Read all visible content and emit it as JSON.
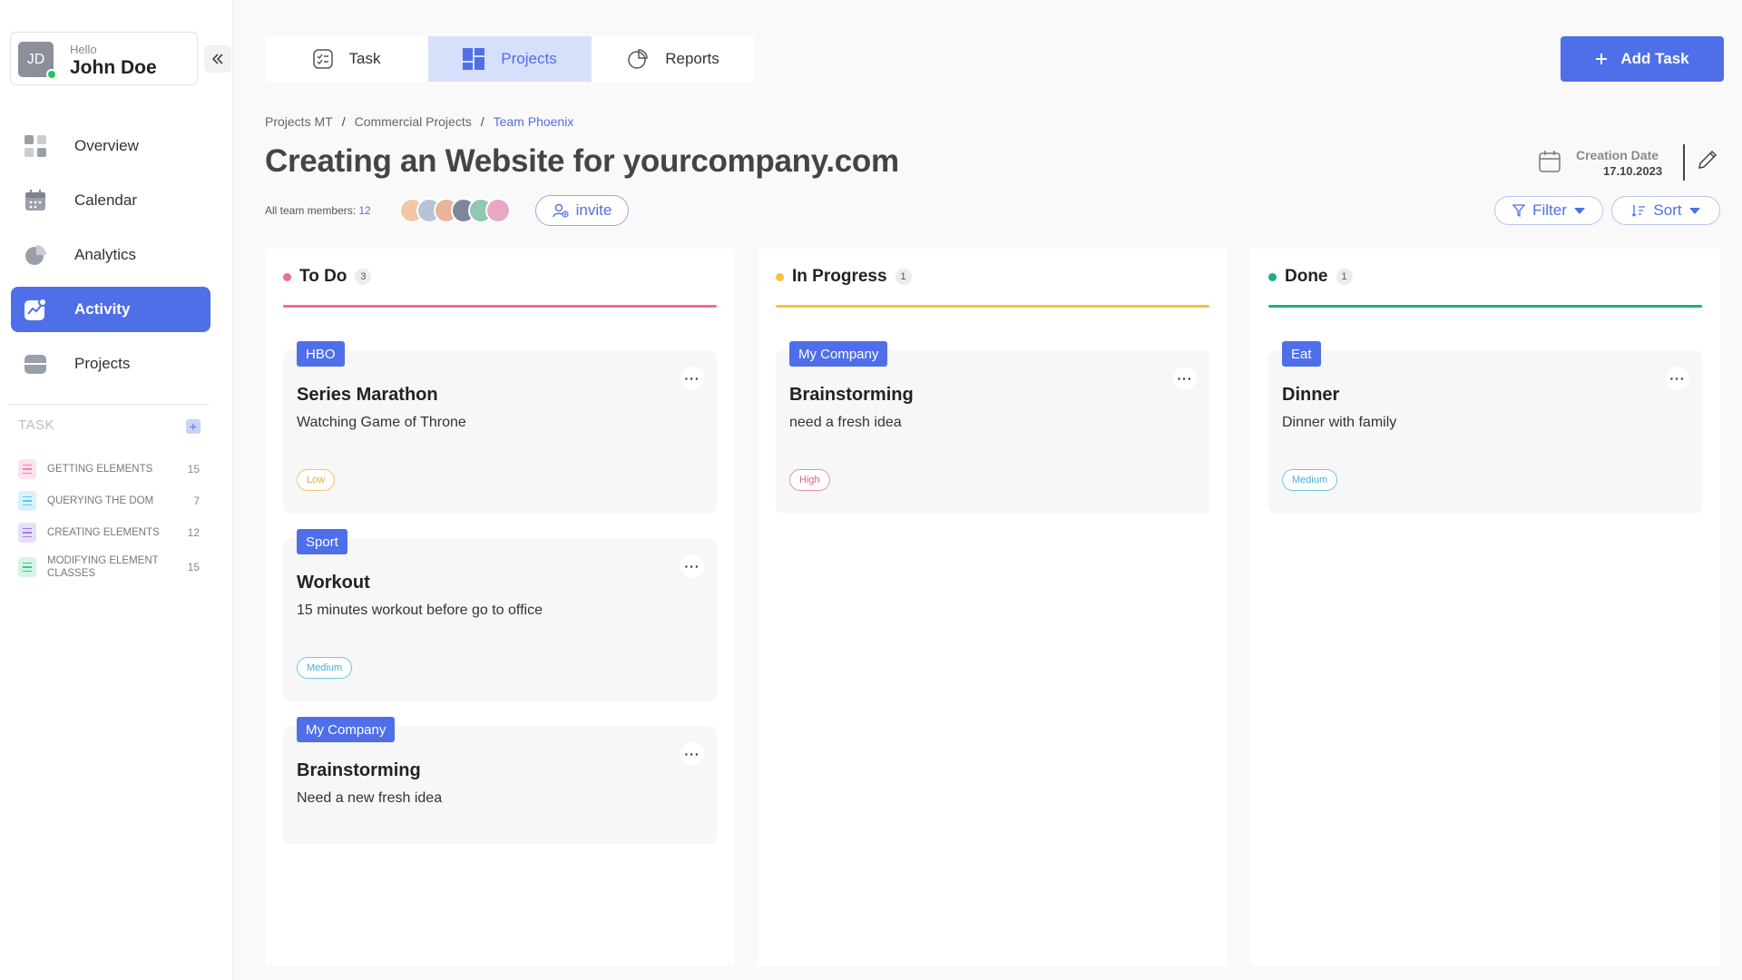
{
  "user": {
    "greeting": "Hello",
    "name": "John Doe",
    "initials": "JD"
  },
  "sidebar": {
    "nav": [
      {
        "label": "Overview"
      },
      {
        "label": "Calendar"
      },
      {
        "label": "Analytics"
      },
      {
        "label": "Activity",
        "active": true
      },
      {
        "label": "Projects"
      }
    ],
    "task_header": "TASK",
    "tasks": [
      {
        "label": "GETTING ELEMENTS",
        "count": "15",
        "color": "#f47fb0"
      },
      {
        "label": "QUERYING THE DOM",
        "count": "7",
        "color": "#5cc9f0"
      },
      {
        "label": "CREATING ELEMENTS",
        "count": "12",
        "color": "#9b7ef0"
      },
      {
        "label": "MODIFYING ELEMENT CLASSES",
        "count": "15",
        "color": "#37c98d"
      }
    ]
  },
  "tabs": [
    {
      "label": "Task"
    },
    {
      "label": "Projects",
      "active": true
    },
    {
      "label": "Reports"
    }
  ],
  "add_task_label": "Add Task",
  "breadcrumb": [
    "Projects MT",
    "Commercial Projects",
    "Team Phoenix"
  ],
  "page_title": "Creating an Website for yourcompany.com",
  "creation": {
    "label": "Creation Date",
    "value": "17.10.2023"
  },
  "team": {
    "label": "All team members:",
    "count": "12"
  },
  "invite_label": "invite",
  "filter_label": "Filter",
  "sort_label": "Sort",
  "colors": {
    "accent": "#4f6fe8",
    "todo": "#f06a9b",
    "progress": "#f7c13b",
    "done": "#1fae83"
  },
  "columns": [
    {
      "title": "To Do",
      "count": "3",
      "cards": [
        {
          "tag": "HBO",
          "title": "Series Marathon",
          "desc": "Watching Game of Throne",
          "priority": "Low"
        },
        {
          "tag": "Sport",
          "title": "Workout",
          "desc": "15 minutes workout before go to office",
          "priority": "Medium"
        },
        {
          "tag": "My Company",
          "title": "Brainstorming",
          "desc": "Need a new fresh idea",
          "priority": ""
        }
      ]
    },
    {
      "title": "In Progress",
      "count": "1",
      "cards": [
        {
          "tag": "My Company",
          "title": "Brainstorming",
          "desc": "need a fresh idea",
          "priority": "High"
        }
      ]
    },
    {
      "title": "Done",
      "count": "1",
      "cards": [
        {
          "tag": "Eat",
          "title": "Dinner",
          "desc": "Dinner with family",
          "priority": "Medium"
        }
      ]
    }
  ]
}
